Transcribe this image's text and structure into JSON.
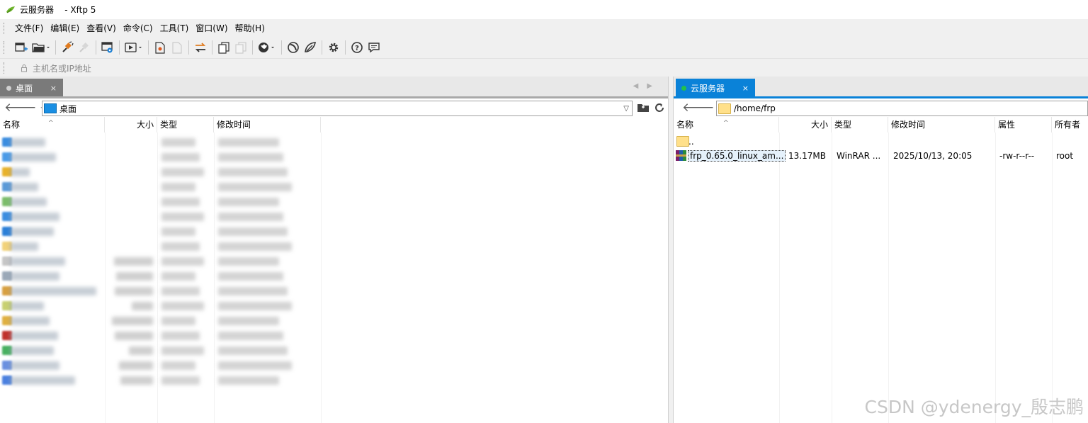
{
  "window": {
    "title": "云服务器    - Xftp 5"
  },
  "menu": [
    "文件(F)",
    "编辑(E)",
    "查看(V)",
    "命令(C)",
    "工具(T)",
    "窗口(W)",
    "帮助(H)"
  ],
  "address": {
    "placeholder": "主机名或IP地址"
  },
  "left_pane": {
    "tab_label": "桌面",
    "tab_close": "×",
    "path": "桌面",
    "columns": {
      "name": "名称",
      "size": "大小",
      "type": "类型",
      "modified": "修改时间"
    }
  },
  "right_pane": {
    "tab_label": "云服务器",
    "tab_close": "×",
    "path": "/home/frp",
    "columns": {
      "name": "名称",
      "size": "大小",
      "type": "类型",
      "modified": "修改时间",
      "attr": "属性",
      "owner": "所有者"
    },
    "rows": [
      {
        "name": "..",
        "size": "",
        "type": "",
        "modified": "",
        "attr": "",
        "owner": ""
      },
      {
        "name": "frp_0.65.0_linux_am...",
        "size": "13.17MB",
        "type": "WinRAR ...",
        "modified": "2025/10/13, 20:05",
        "attr": "-rw-r--r--",
        "owner": "root"
      }
    ]
  },
  "watermark": "CSDN @ydenergy_殷志鹏"
}
